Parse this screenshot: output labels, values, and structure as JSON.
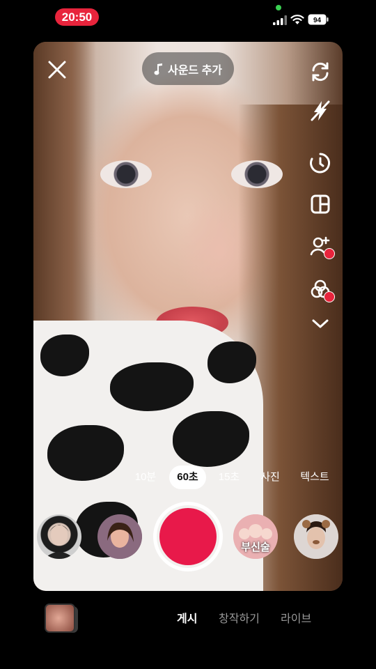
{
  "status": {
    "time": "20:50",
    "battery": "94"
  },
  "top": {
    "sound_label": "사운드 추가"
  },
  "side_tools": [
    {
      "icon": "flip-camera-icon"
    },
    {
      "icon": "flash-off-icon"
    },
    {
      "icon": "timer-icon"
    },
    {
      "icon": "layout-icon"
    },
    {
      "icon": "add-person-icon"
    },
    {
      "icon": "beauty-filter-icon"
    },
    {
      "icon": "chevron-down-icon"
    }
  ],
  "modes": [
    "10분",
    "60초",
    "15초",
    "사진",
    "텍스트"
  ],
  "active_mode": "60초",
  "effects": {
    "text_effect_label": "부신술"
  },
  "bottom_tabs": [
    "게시",
    "창작하기",
    "라이브"
  ],
  "active_tab": "게시",
  "colors": {
    "accent": "#e8194a",
    "status_pill": "#e8243c"
  }
}
